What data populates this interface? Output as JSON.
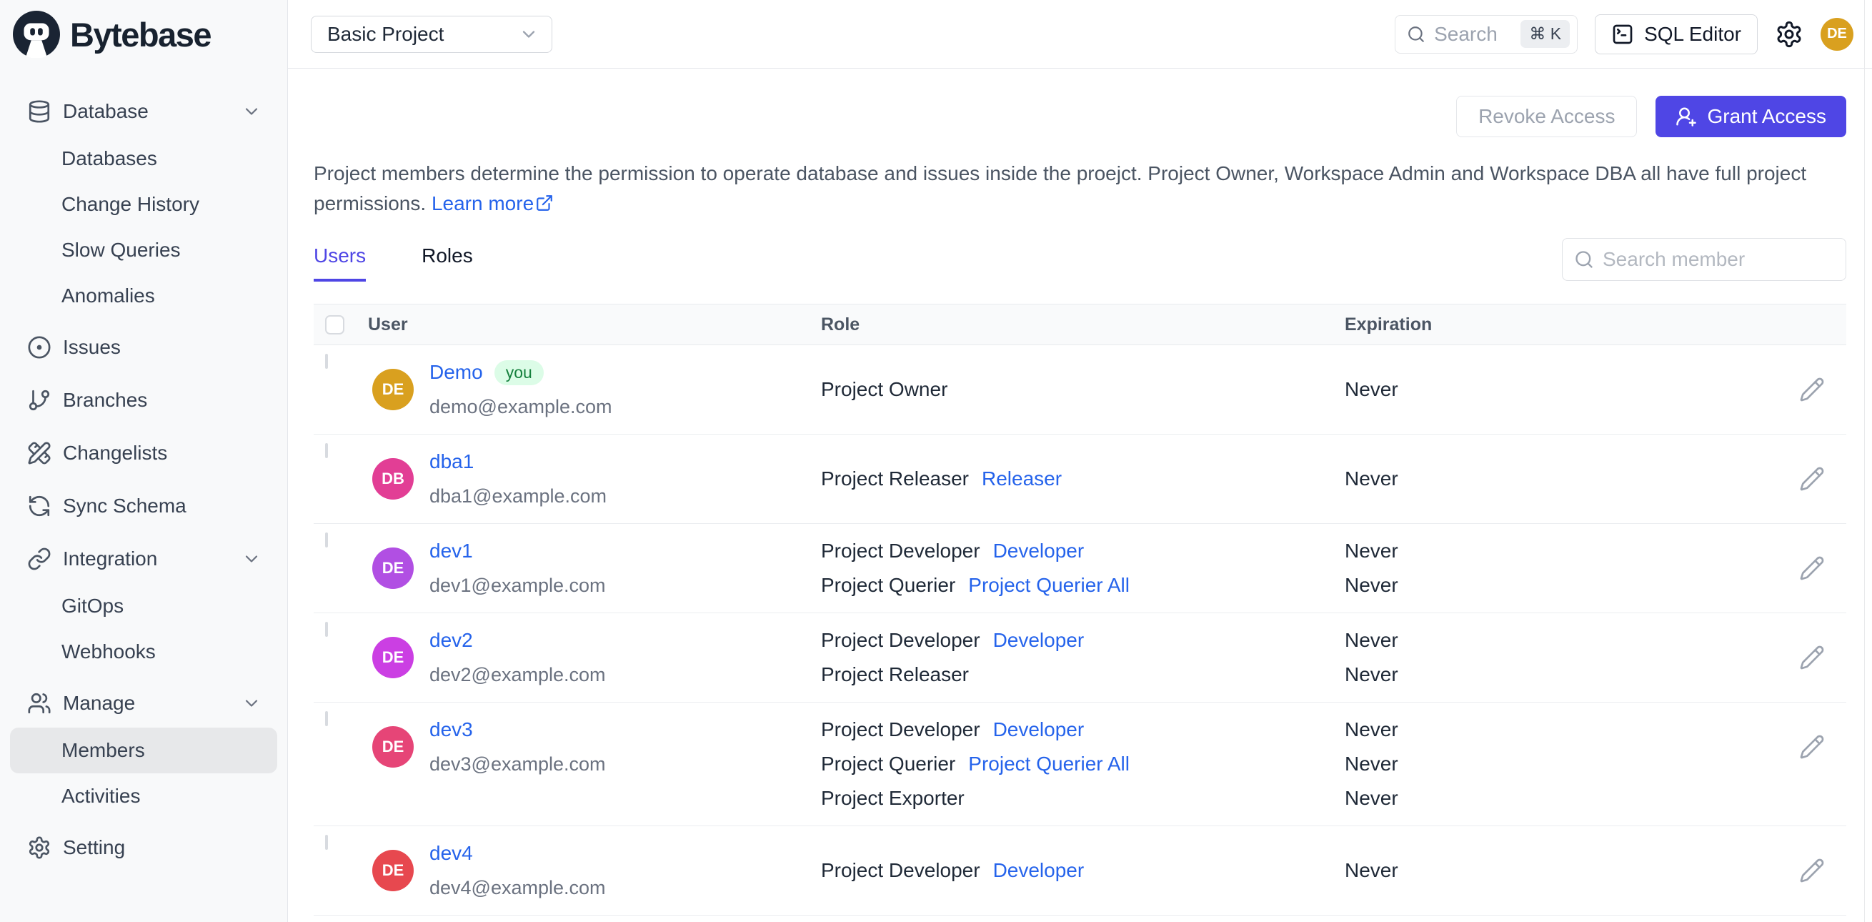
{
  "brand": {
    "name": "Bytebase"
  },
  "topbar": {
    "project_selector": {
      "value": "Basic Project"
    },
    "search": {
      "placeholder": "Search",
      "shortcut": "⌘ K"
    },
    "sql_editor_label": "SQL Editor",
    "user_avatar_initials": "DE"
  },
  "sidebar": {
    "items": [
      {
        "label": "Database",
        "icon": "database",
        "level": 0,
        "chevron": true
      },
      {
        "label": "Databases",
        "level": 1
      },
      {
        "label": "Change History",
        "level": 1
      },
      {
        "label": "Slow Queries",
        "level": 1
      },
      {
        "label": "Anomalies",
        "level": 1
      },
      {
        "label": "Issues",
        "icon": "circle-dot",
        "level": 0
      },
      {
        "label": "Branches",
        "icon": "git-branch",
        "level": 0
      },
      {
        "label": "Changelists",
        "icon": "pencil-ruler",
        "level": 0
      },
      {
        "label": "Sync Schema",
        "icon": "refresh",
        "level": 0
      },
      {
        "label": "Integration",
        "icon": "link",
        "level": 0,
        "chevron": true
      },
      {
        "label": "GitOps",
        "level": 1
      },
      {
        "label": "Webhooks",
        "level": 1
      },
      {
        "label": "Manage",
        "icon": "users",
        "level": 0,
        "chevron": true
      },
      {
        "label": "Members",
        "level": 1,
        "active": true
      },
      {
        "label": "Activities",
        "level": 1
      },
      {
        "label": "Setting",
        "icon": "gear",
        "level": 0
      }
    ]
  },
  "page": {
    "actions": {
      "revoke_label": "Revoke Access",
      "grant_label": "Grant Access"
    },
    "description": {
      "text": "Project members determine the permission to operate database and issues inside the proejct. Project Owner, Workspace Admin and Workspace DBA all have full project permissions.",
      "learn_more_label": "Learn more"
    },
    "tabs": [
      {
        "label": "Users",
        "active": true
      },
      {
        "label": "Roles",
        "active": false
      }
    ],
    "member_search_placeholder": "Search member",
    "table": {
      "columns": [
        "User",
        "Role",
        "Expiration"
      ],
      "rows": [
        {
          "initials": "DE",
          "avatar_color": "#d9a01f",
          "name": "Demo",
          "you_badge": "you",
          "email": "demo@example.com",
          "roles": [
            {
              "role": "Project Owner"
            }
          ],
          "expirations": [
            "Never"
          ]
        },
        {
          "initials": "DB",
          "avatar_color": "#e23e95",
          "name": "dba1",
          "email": "dba1@example.com",
          "roles": [
            {
              "role": "Project Releaser",
              "link": "Releaser"
            }
          ],
          "expirations": [
            "Never"
          ]
        },
        {
          "initials": "DE",
          "avatar_color": "#b14fe3",
          "name": "dev1",
          "email": "dev1@example.com",
          "roles": [
            {
              "role": "Project Developer",
              "link": "Developer"
            },
            {
              "role": "Project Querier",
              "link": "Project Querier All"
            }
          ],
          "expirations": [
            "Never",
            "Never"
          ]
        },
        {
          "initials": "DE",
          "avatar_color": "#cb3fe3",
          "name": "dev2",
          "email": "dev2@example.com",
          "roles": [
            {
              "role": "Project Developer",
              "link": "Developer"
            },
            {
              "role": "Project Releaser"
            }
          ],
          "expirations": [
            "Never",
            "Never"
          ]
        },
        {
          "initials": "DE",
          "avatar_color": "#e64577",
          "name": "dev3",
          "email": "dev3@example.com",
          "roles": [
            {
              "role": "Project Developer",
              "link": "Developer"
            },
            {
              "role": "Project Querier",
              "link": "Project Querier All"
            },
            {
              "role": "Project Exporter"
            }
          ],
          "expirations": [
            "Never",
            "Never",
            "Never"
          ]
        },
        {
          "initials": "DE",
          "avatar_color": "#e7484f",
          "name": "dev4",
          "email": "dev4@example.com",
          "roles": [
            {
              "role": "Project Developer",
              "link": "Developer"
            }
          ],
          "expirations": [
            "Never"
          ]
        }
      ]
    }
  },
  "colors": {
    "accent": "#4f46e5",
    "link": "#2563eb",
    "you_badge_bg": "#dcfce7",
    "you_badge_text": "#15803d"
  }
}
